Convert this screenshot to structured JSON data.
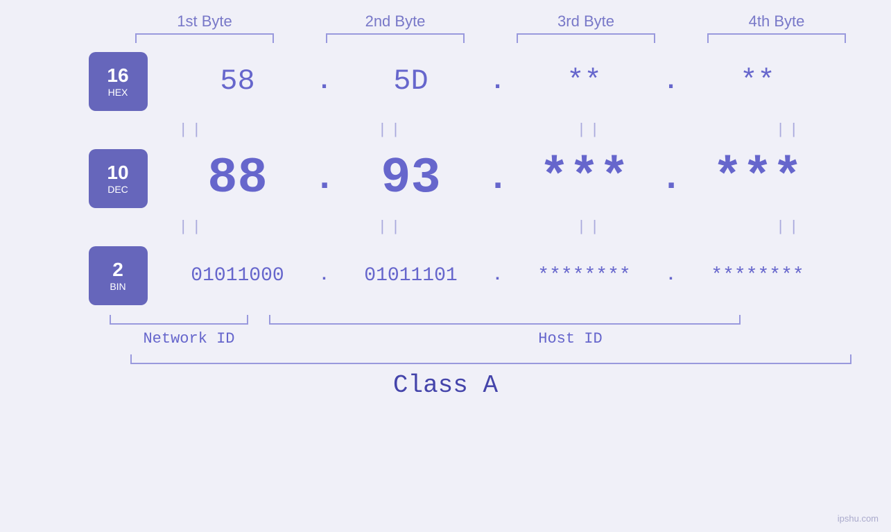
{
  "headers": {
    "byte1": "1st Byte",
    "byte2": "2nd Byte",
    "byte3": "3rd Byte",
    "byte4": "4th Byte"
  },
  "badges": {
    "hex": {
      "number": "16",
      "label": "HEX"
    },
    "dec": {
      "number": "10",
      "label": "DEC"
    },
    "bin": {
      "number": "2",
      "label": "BIN"
    }
  },
  "rows": {
    "hex": {
      "b1": "58",
      "b2": "5D",
      "b3": "**",
      "b4": "**",
      "dot": "."
    },
    "dec": {
      "b1": "88",
      "b2": "93",
      "b3": "***",
      "b4": "***",
      "dot": "."
    },
    "bin": {
      "b1": "01011000",
      "b2": "01011101",
      "b3": "********",
      "b4": "********",
      "dot": "."
    }
  },
  "equals": "||",
  "labels": {
    "network_id": "Network ID",
    "host_id": "Host ID",
    "class": "Class A"
  },
  "watermark": "ipshu.com"
}
